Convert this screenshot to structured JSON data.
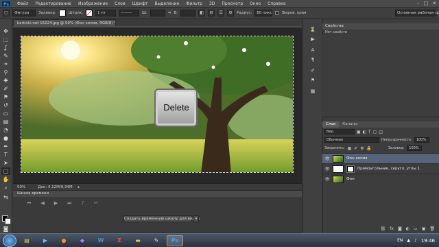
{
  "menubar": {
    "logo": "Ps",
    "items": [
      "Файл",
      "Редактирование",
      "Изображение",
      "Слои",
      "Шрифт",
      "Выделение",
      "Фильтр",
      "3D",
      "Просмотр",
      "Окно",
      "Справка"
    ]
  },
  "options": {
    "shape_mode": "Фигура",
    "fill_label": "Заливка:",
    "stroke_label": "Штрих:",
    "stroke_width": "1 пт",
    "w_label": "Ш:",
    "h_label": "В:",
    "radius_label": "Радиус:",
    "radius_value": "80 пикс",
    "align_edges": "Выров. края",
    "workspace": "Основная рабочая среда"
  },
  "document": {
    "tab_title": "kartinki.net 16224.jpg @ 50% (Фон копия, RGB/8) *",
    "zoom": "50%",
    "doc_info": "Док: 4,12M/9,34M",
    "overlay_key_label": "Delete"
  },
  "timeline": {
    "tab_label": "Шкала времени",
    "create_button": "Создать временную шкалу для видео"
  },
  "properties": {
    "tab_label": "Свойства",
    "no_props": "Нет свойств"
  },
  "layers": {
    "tabs": [
      "Слои",
      "Каналы"
    ],
    "filter_kind": "Вид",
    "blend_mode": "Обычные",
    "opacity_label": "Непрозрачность:",
    "opacity_value": "100%",
    "lock_label": "Закрепить:",
    "fill_label": "Заливка:",
    "fill_value": "100%",
    "items": [
      {
        "name": "Фон копия"
      },
      {
        "name": "Прямоугольник, скругл. углы 1"
      },
      {
        "name": "Фон"
      }
    ]
  },
  "taskbar": {
    "language": "EN",
    "clock": "19:46",
    "apps": [
      "explorer",
      "media",
      "firefox",
      "app",
      "word",
      "filezilla",
      "folder",
      "paint",
      "photoshop"
    ]
  },
  "colors": {
    "accent": "#56647a",
    "chrome": "#3b3b3b",
    "photoshop": "#39a3ff"
  }
}
